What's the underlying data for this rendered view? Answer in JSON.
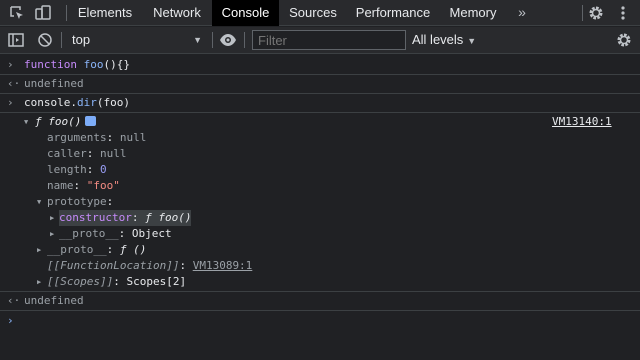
{
  "tabs": {
    "items": [
      {
        "label": "Elements"
      },
      {
        "label": "Network"
      },
      {
        "label": "Console"
      },
      {
        "label": "Sources"
      },
      {
        "label": "Performance"
      },
      {
        "label": "Memory"
      }
    ],
    "active": "Console",
    "more": "»"
  },
  "toolbar": {
    "context": "top",
    "filter_placeholder": "Filter",
    "levels": "All levels"
  },
  "console": {
    "l1": {
      "kw": "function",
      "name": "foo",
      "rest": "(){}"
    },
    "l2": "undefined",
    "l3": {
      "obj": "console",
      "dot": ".",
      "method": "dir",
      "args": "(foo)"
    },
    "l4": {
      "f": "ƒ",
      "sig": "foo()",
      "source": "VM13140:1"
    },
    "arguments": {
      "key": "arguments",
      "val": "null"
    },
    "caller": {
      "key": "caller",
      "val": "null"
    },
    "length": {
      "key": "length",
      "val": "0"
    },
    "name": {
      "key": "name",
      "val": "\"foo\""
    },
    "prototype": {
      "key": "prototype"
    },
    "constructor": {
      "key": "constructor",
      "f": "ƒ",
      "sig": "foo()"
    },
    "proto_inner": {
      "key": "__proto__",
      "val": "Object"
    },
    "proto_outer": {
      "key": "__proto__",
      "f": "ƒ",
      "sig": "()"
    },
    "fnloc": {
      "key": "[[FunctionLocation]]",
      "val": "VM13089:1"
    },
    "scopes": {
      "key": "[[Scopes]]",
      "val": "Scopes[2]"
    },
    "l_last": "undefined"
  },
  "colors": {
    "bg": "#202124",
    "toolbar": "#292a2d",
    "active_tab": "#000000",
    "keyword": "#c58af9",
    "function_name": "#8ab4f8",
    "number": "#999ef5",
    "string": "#f28b82"
  },
  "icons": [
    "inspect-icon",
    "device-toggle-icon",
    "double-chevron-icon",
    "settings-gear-icon",
    "more-menu-icon",
    "sidebar-toggle-icon",
    "clear-console-icon",
    "eye-icon",
    "console-settings-icon"
  ]
}
